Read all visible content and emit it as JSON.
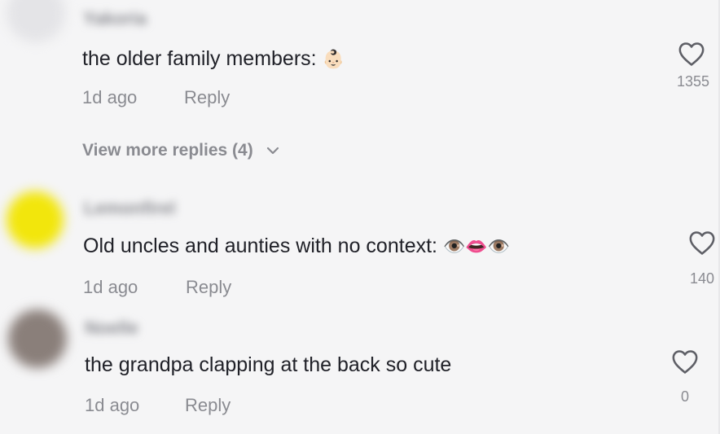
{
  "comments": [
    {
      "username": "Yakoria",
      "text": "the older family members: ",
      "emoji": "👶🏻",
      "time": "1d ago",
      "reply_label": "Reply",
      "likes": "1355"
    },
    {
      "username": "Lemonfirel",
      "text": "Old uncles and aunties with no context: ",
      "emoji": "👁️👄👁️",
      "time": "1d ago",
      "reply_label": "Reply",
      "likes": "140"
    },
    {
      "username": "Noelle",
      "text": "the grandpa clapping at the back so cute",
      "emoji": "",
      "time": "1d ago",
      "reply_label": "Reply",
      "likes": "0"
    }
  ],
  "view_more": "View more replies (4)",
  "colors": {
    "background": "#f5f5f6",
    "text": "#202128",
    "muted": "#8a8b91",
    "avatar2": "#f2e60c"
  },
  "icons": [
    "heart-outline-icon",
    "chevron-down-icon"
  ]
}
